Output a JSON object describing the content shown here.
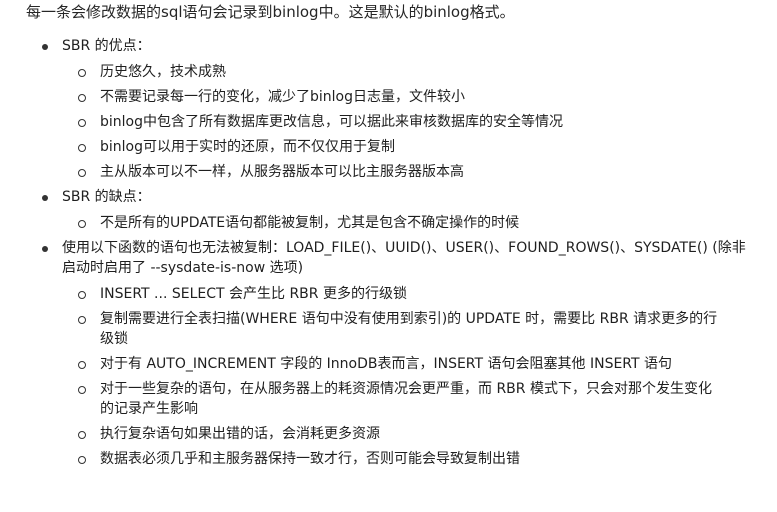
{
  "intro": "每一条会修改数据的sql语句会记录到binlog中。这是默认的binlog格式。",
  "sbr_pros": {
    "title": "SBR 的优点：",
    "items": [
      "历史悠久，技术成熟",
      "不需要记录每一行的变化，减少了binlog日志量，文件较小",
      "binlog中包含了所有数据库更改信息，可以据此来审核数据库的安全等情况",
      "binlog可以用于实时的还原，而不仅仅用于复制",
      "主从版本可以不一样，从服务器版本可以比主服务器版本高"
    ]
  },
  "sbr_cons": {
    "title": "SBR 的缺点：",
    "items": [
      "不是所有的UPDATE语句都能被复制，尤其是包含不确定操作的时候"
    ]
  },
  "functions_note": {
    "text": "使用以下函数的语句也无法被复制：LOAD_FILE()、UUID()、USER()、FOUND_ROWS()、SYSDATE() (除非启动时启用了 --sysdate-is-now 选项)",
    "items": [
      "INSERT ... SELECT 会产生比 RBR 更多的行级锁",
      "复制需要进行全表扫描(WHERE 语句中没有使用到索引)的 UPDATE 时，需要比 RBR 请求更多的行级锁",
      "对于有 AUTO_INCREMENT 字段的 InnoDB表而言，INSERT 语句会阻塞其他 INSERT 语句",
      "对于一些复杂的语句，在从服务器上的耗资源情况会更严重，而 RBR 模式下，只会对那个发生变化的记录产生影响",
      "执行复杂语句如果出错的话，会消耗更多资源",
      "数据表必须几乎和主服务器保持一致才行，否则可能会导致复制出错"
    ]
  }
}
